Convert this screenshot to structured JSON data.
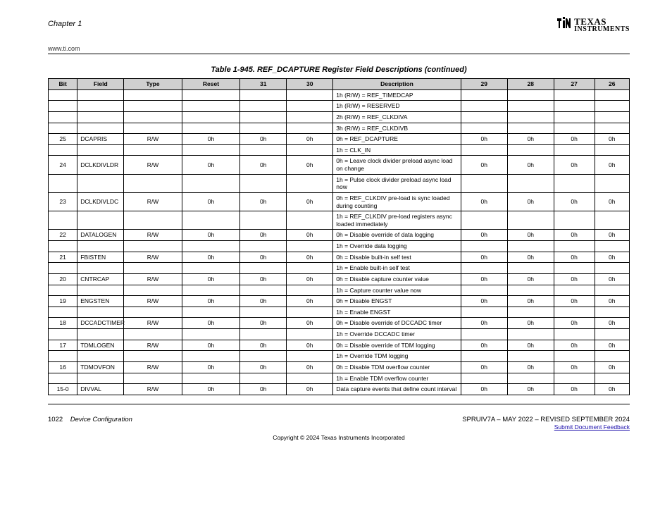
{
  "header": {
    "chapter": "Chapter 1",
    "url": "www.ti.com",
    "logo_line1": "TEXAS",
    "logo_line2": "INSTRUMENTS"
  },
  "caption": "Table 1-945. REF_DCAPTURE Register Field Descriptions (continued)",
  "columns": [
    "Bit",
    "Field",
    "Type",
    "Reset",
    "31",
    "30",
    "Description",
    "29",
    "28",
    "27",
    "26"
  ],
  "col_widths": [
    "5%",
    "8%",
    "10%",
    "10%",
    "8%",
    "8%",
    "22%",
    "8%",
    "8%",
    "7%",
    "6%"
  ],
  "rows": [
    [
      "",
      "",
      "",
      "",
      "",
      "",
      "1h (R/W) = REF_TIMEDCAP",
      "",
      "",
      "",
      ""
    ],
    [
      "",
      "",
      "",
      "",
      "",
      "",
      "1h (R/W) = RESERVED",
      "",
      "",
      "",
      ""
    ],
    [
      "",
      "",
      "",
      "",
      "",
      "",
      "2h (R/W) = REF_CLKDIVA",
      "",
      "",
      "",
      ""
    ],
    [
      "",
      "",
      "",
      "",
      "",
      "",
      "3h (R/W) = REF_CLKDIVB",
      "",
      "",
      "",
      ""
    ],
    [
      "25",
      "DCAPRIS",
      "R/W",
      "0h",
      "0h",
      "0h",
      "0h = REF_DCAPTURE",
      "0h",
      "0h",
      "0h",
      "0h"
    ],
    [
      "",
      "",
      "",
      "",
      "",
      "",
      "1h = CLK_IN",
      "",
      "",
      "",
      ""
    ],
    [
      "24",
      "DCLKDIVLDR",
      "R/W",
      "0h",
      "0h",
      "0h",
      "0h = Leave clock divider preload async load on change",
      "0h",
      "0h",
      "0h",
      "0h"
    ],
    [
      "",
      "",
      "",
      "",
      "",
      "",
      "1h = Pulse clock divider preload async load now",
      "",
      "",
      "",
      ""
    ],
    [
      "23",
      "DCLKDIVLDC",
      "R/W",
      "0h",
      "0h",
      "0h",
      "0h = REF_CLKDIV pre-load is sync loaded during counting",
      "0h",
      "0h",
      "0h",
      "0h"
    ],
    [
      "",
      "",
      "",
      "",
      "",
      "",
      "1h = REF_CLKDIV pre-load registers async loaded immediately",
      "",
      "",
      "",
      ""
    ],
    [
      "22",
      "DATALOGEN",
      "R/W",
      "0h",
      "0h",
      "0h",
      "0h = Disable override of data logging",
      "0h",
      "0h",
      "0h",
      "0h"
    ],
    [
      "",
      "",
      "",
      "",
      "",
      "",
      "1h = Override data logging",
      "",
      "",
      "",
      ""
    ],
    [
      "21",
      "FBISTEN",
      "R/W",
      "0h",
      "0h",
      "0h",
      "0h = Disable built-in self test",
      "0h",
      "0h",
      "0h",
      "0h"
    ],
    [
      "",
      "",
      "",
      "",
      "",
      "",
      "1h = Enable built-in self test",
      "",
      "",
      "",
      ""
    ],
    [
      "20",
      "CNTRCAP",
      "R/W",
      "0h",
      "0h",
      "0h",
      "0h = Disable capture counter value",
      "0h",
      "0h",
      "0h",
      "0h"
    ],
    [
      "",
      "",
      "",
      "",
      "",
      "",
      "1h = Capture counter value now",
      "",
      "",
      "",
      ""
    ],
    [
      "19",
      "ENGSTEN",
      "R/W",
      "0h",
      "0h",
      "0h",
      "0h = Disable ENGST",
      "0h",
      "0h",
      "0h",
      "0h"
    ],
    [
      "",
      "",
      "",
      "",
      "",
      "",
      "1h = Enable ENGST",
      "",
      "",
      "",
      ""
    ],
    [
      "18",
      "DCCADCTIMER",
      "R/W",
      "0h",
      "0h",
      "0h",
      "0h = Disable override of DCCADC timer",
      "0h",
      "0h",
      "0h",
      "0h"
    ],
    [
      "",
      "",
      "",
      "",
      "",
      "",
      "1h = Override DCCADC timer",
      "",
      "",
      "",
      ""
    ],
    [
      "17",
      "TDMLOGEN",
      "R/W",
      "0h",
      "0h",
      "0h",
      "0h = Disable override of TDM logging",
      "0h",
      "0h",
      "0h",
      "0h"
    ],
    [
      "",
      "",
      "",
      "",
      "",
      "",
      "1h = Override TDM logging",
      "",
      "",
      "",
      ""
    ],
    [
      "16",
      "TDMOVFON",
      "R/W",
      "0h",
      "0h",
      "0h",
      "0h = Disable TDM overflow counter",
      "0h",
      "0h",
      "0h",
      "0h"
    ],
    [
      "",
      "",
      "",
      "",
      "",
      "",
      "1h = Enable TDM overflow counter",
      "",
      "",
      "",
      ""
    ],
    [
      "15-0",
      "DIVVAL",
      "R/W",
      "0h",
      "0h",
      "0h",
      "Data capture events that define count interval",
      "0h",
      "0h",
      "0h",
      "0h"
    ]
  ],
  "footer": {
    "page_num": "1022",
    "doc_title": "Device Configuration",
    "doc_id": "SPRUIV7A – MAY 2022 – REVISED SEPTEMBER 2024",
    "feedback": "Submit Document Feedback",
    "copyright": "Copyright © 2024 Texas Instruments Incorporated"
  }
}
